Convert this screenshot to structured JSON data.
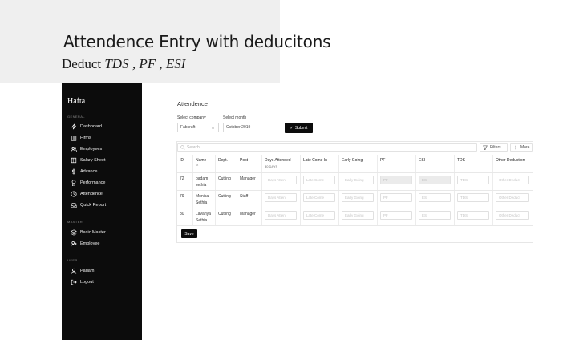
{
  "caption": {
    "title": "Attendence Entry with deducitons",
    "subtitle_prefix": "Deduct ",
    "subtitle_items": "TDS , PF , ESI"
  },
  "sidebar": {
    "brand": "Hafta",
    "sections": [
      {
        "label": "GENERAL",
        "items": [
          {
            "label": "Dashboard",
            "icon": "dashboard-icon"
          },
          {
            "label": "Firms",
            "icon": "building-icon"
          },
          {
            "label": "Employees",
            "icon": "users-icon"
          },
          {
            "label": "Salary Sheet",
            "icon": "sheet-icon"
          },
          {
            "label": "Advance",
            "icon": "dollar-icon"
          },
          {
            "label": "Performance",
            "icon": "award-icon"
          },
          {
            "label": "Attendence",
            "icon": "clock-icon"
          },
          {
            "label": "Quick Report",
            "icon": "inbox-icon"
          }
        ]
      },
      {
        "label": "MASTER",
        "items": [
          {
            "label": "Basic Master",
            "icon": "layers-icon"
          },
          {
            "label": "Employee",
            "icon": "user-plus-icon"
          }
        ]
      },
      {
        "label": "USER",
        "items": [
          {
            "label": "Padam",
            "icon": "user-icon"
          },
          {
            "label": "Logout",
            "icon": "logout-icon"
          }
        ]
      }
    ]
  },
  "main": {
    "title": "Attendence",
    "select_company_label": "Select company",
    "select_company_value": "Fabcraft",
    "select_month_label": "Select month",
    "select_month_value": "October 2019",
    "submit_label": "Submit",
    "search_placeholder": "Search",
    "filters_label": "Filters",
    "more_label": "More",
    "save_label": "Save"
  },
  "table": {
    "columns": {
      "id": "ID",
      "name": "Name",
      "dept": "Dept.",
      "post": "Post",
      "days_attended": "Days Attended",
      "days_attended_sub": "30 DAYS",
      "late_come_in": "Late Come In",
      "early_going": "Early Going",
      "pf": "PF",
      "esi": "ESI",
      "tds": "TDS",
      "other_deduction": "Other Deduction"
    },
    "placeholders": {
      "days": "Days Atten",
      "late": "Late Come",
      "early": "Early Going",
      "pf": "PF",
      "esi": "ESI",
      "tds": "TDS",
      "other": "Other Deduct"
    },
    "rows": [
      {
        "id": "72",
        "name": "padam sethia",
        "dept": "Cutting",
        "post": "Manager"
      },
      {
        "id": "79",
        "name": "Monica Sethia",
        "dept": "Cutting",
        "post": "Staff"
      },
      {
        "id": "80",
        "name": "Lavanya Sethia",
        "dept": "Cutting",
        "post": "Manager"
      }
    ]
  }
}
